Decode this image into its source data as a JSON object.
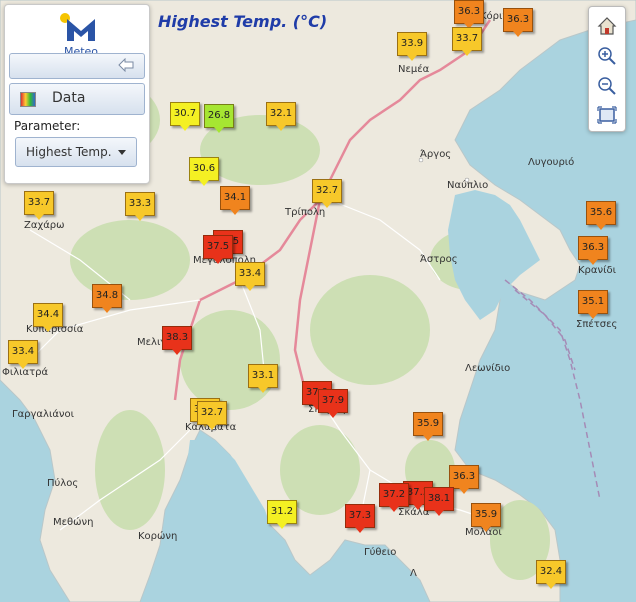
{
  "app": {
    "logo_text": "Meteo",
    "title": "Highest Temp. (°C)"
  },
  "panel": {
    "data_label": "Data",
    "parameter_label": "Parameter:",
    "parameter_value": "Highest Temp."
  },
  "controls": {
    "home": "home-icon",
    "zoom_in": "zoom-in-icon",
    "zoom_out": "zoom-out-icon",
    "extent": "zoom-extent-icon"
  },
  "colors": {
    "hot": "#e8321a",
    "warm": "#f0841e",
    "mild": "#f7c82a",
    "yellow": "#f4f023",
    "green": "#a6e632"
  },
  "places": [
    "Κόρινθος",
    "Νεμέα",
    "Άργος",
    "Ναύπλιο",
    "Λυγουριό",
    "Τρίπολη",
    "Ζαχάρω",
    "Μεγαλόπολη",
    "Άστρος",
    "Κρανίδι",
    "Σπέτσες",
    "Κυπαρισσία",
    "Μελιγαλάς",
    "Φιλιατρά",
    "Γαργαλιάνοι",
    "Καλαμάτα",
    "Σπάρτη",
    "Λεωνίδιο",
    "Πύλος",
    "Μεθώνη",
    "Κορώνη",
    "Σκάλα",
    "Μολάοι",
    "Γύθειο",
    "Λ"
  ],
  "stations": [
    {
      "value": "36.3",
      "level": "warm"
    },
    {
      "value": "33.9",
      "level": "mild"
    },
    {
      "value": "33.7",
      "level": "mild"
    },
    {
      "value": "30.7",
      "level": "yellow"
    },
    {
      "value": "26.8",
      "level": "green"
    },
    {
      "value": "32.1",
      "level": "mild"
    },
    {
      "value": "30.6",
      "level": "yellow"
    },
    {
      "value": "34.1",
      "level": "warm"
    },
    {
      "value": "33.7",
      "level": "mild"
    },
    {
      "value": "33.3",
      "level": "mild"
    },
    {
      "value": "32.7",
      "level": "mild"
    },
    {
      "value": "37.5",
      "level": "hot"
    },
    {
      "value": "33.4",
      "level": "mild"
    },
    {
      "value": "35.6",
      "level": "warm"
    },
    {
      "value": "36.3",
      "level": "warm"
    },
    {
      "value": "34.8",
      "level": "warm"
    },
    {
      "value": "34.4",
      "level": "mild"
    },
    {
      "value": "35.1",
      "level": "warm"
    },
    {
      "value": "33.4",
      "level": "mild"
    },
    {
      "value": "38.3",
      "level": "hot"
    },
    {
      "value": "33.1",
      "level": "mild"
    },
    {
      "value": "37.9",
      "level": "hot"
    },
    {
      "value": "32.7",
      "level": "mild"
    },
    {
      "value": "35.9",
      "level": "warm"
    },
    {
      "value": "36.3",
      "level": "warm"
    },
    {
      "value": "37.2",
      "level": "hot"
    },
    {
      "value": "38.1",
      "level": "hot"
    },
    {
      "value": "35.9",
      "level": "warm"
    },
    {
      "value": "31.2",
      "level": "yellow"
    },
    {
      "value": "37.3",
      "level": "hot"
    },
    {
      "value": "32.4",
      "level": "mild"
    }
  ]
}
